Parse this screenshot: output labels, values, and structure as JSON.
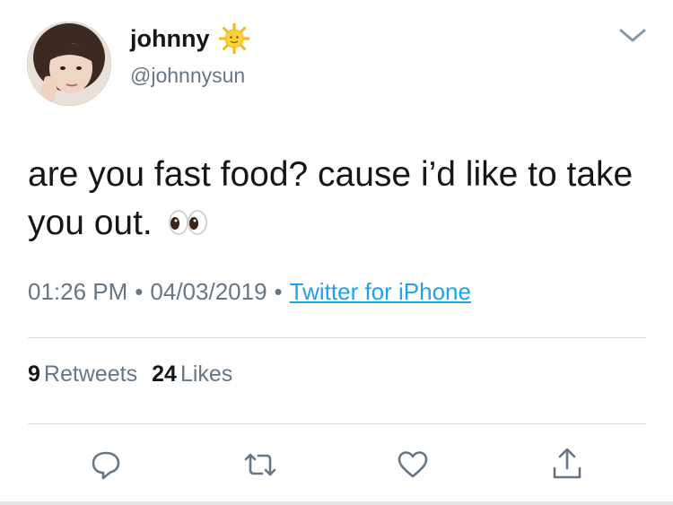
{
  "user": {
    "display_name": "johnny",
    "handle": "@johnnysun",
    "name_emoji": "sun-with-face-emoji"
  },
  "tweet": {
    "text": "are you fast food? cause i’d like to take you out.",
    "text_emoji": "eyes-emoji"
  },
  "meta": {
    "time": "01:26 PM",
    "separator": "•",
    "date": "04/03/2019",
    "source": "Twitter for iPhone"
  },
  "stats": {
    "retweets_count": "9",
    "retweets_label": "Retweets",
    "likes_count": "24",
    "likes_label": "Likes"
  },
  "actions": [
    "reply-icon",
    "retweet-icon",
    "like-icon",
    "share-icon"
  ],
  "colors": {
    "text": "#14171a",
    "secondary": "#657786",
    "link": "#1da1f2",
    "divider": "#d8dde2"
  }
}
